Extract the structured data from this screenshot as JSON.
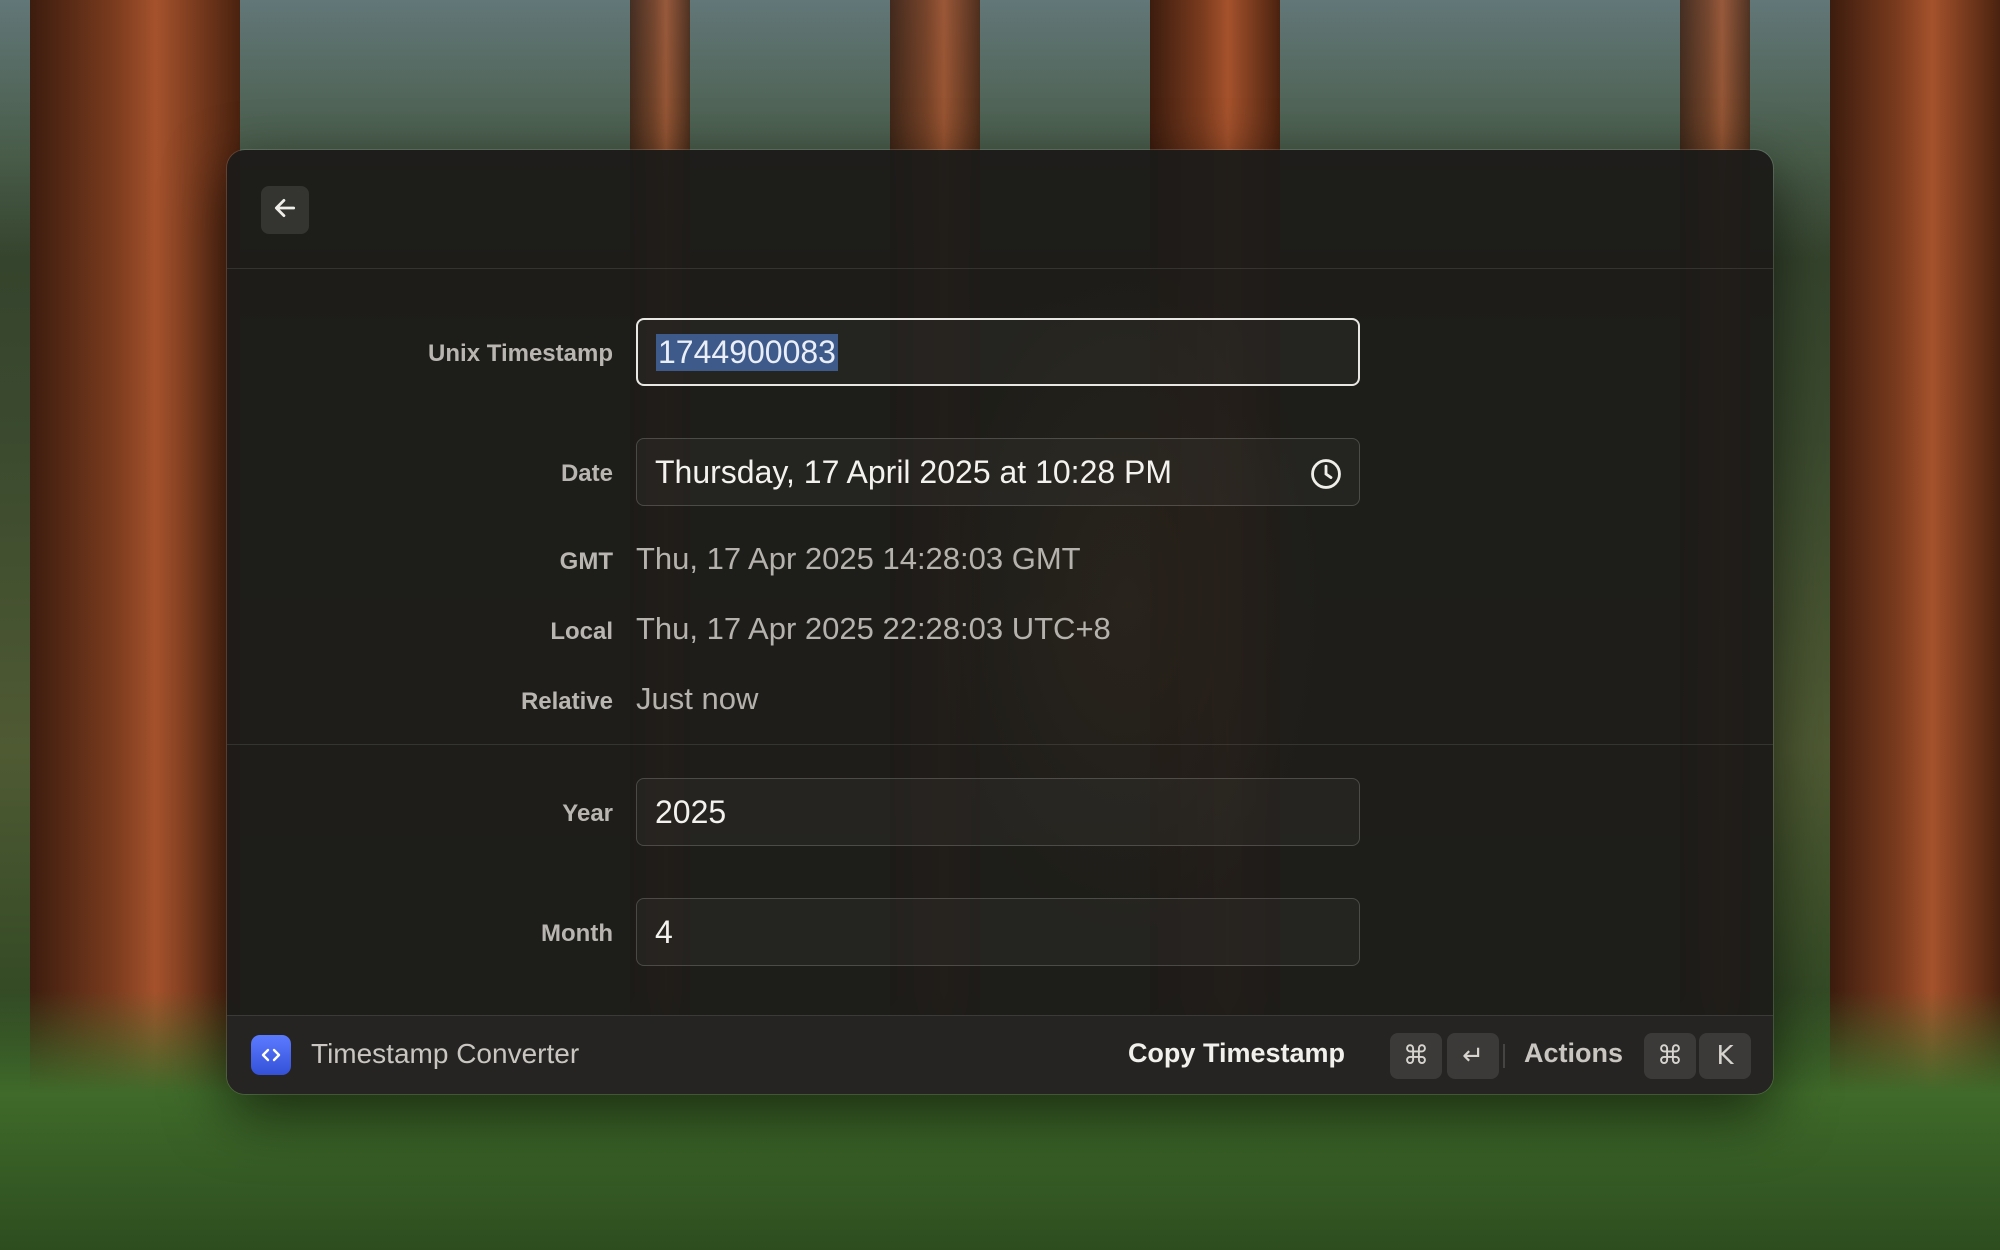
{
  "window": {
    "app_name": "Timestamp Converter"
  },
  "form": {
    "unix_label": "Unix Timestamp",
    "unix_value": "1744900083",
    "date_label": "Date",
    "date_value": "Thursday, 17 April 2025 at 10:28 PM",
    "gmt_label": "GMT",
    "gmt_value": "Thu, 17 Apr 2025 14:28:03 GMT",
    "local_label": "Local",
    "local_value": "Thu, 17 Apr 2025 22:28:03 UTC+8",
    "relative_label": "Relative",
    "relative_value": "Just now",
    "year_label": "Year",
    "year_value": "2025",
    "month_label": "Month",
    "month_value": "4"
  },
  "footer": {
    "primary_action": "Copy Timestamp",
    "primary_key_1": "⌘",
    "primary_key_2": "↵",
    "actions_label": "Actions",
    "actions_key_1": "⌘",
    "actions_key_2": "K"
  },
  "icons": {
    "back": "arrow-left-icon",
    "date_picker": "clock-icon",
    "app": "code-brackets-icon"
  },
  "colors": {
    "accent": "#4a68f0",
    "selection": "#3d5a8a"
  }
}
